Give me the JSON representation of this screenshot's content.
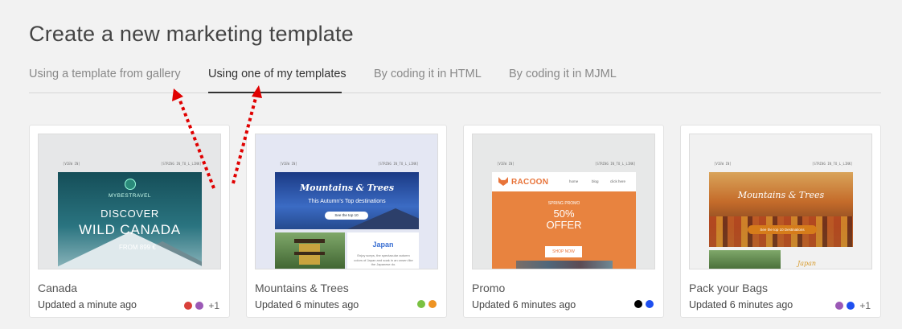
{
  "page": {
    "title": "Create a new marketing template"
  },
  "tabs": [
    {
      "label": "Using a template from gallery",
      "active": false
    },
    {
      "label": "Using one of my templates",
      "active": true
    },
    {
      "label": "By coding it in HTML",
      "active": false
    },
    {
      "label": "By coding it in MJML",
      "active": false
    }
  ],
  "cards": [
    {
      "name": "Canada",
      "updated": "Updated a minute ago",
      "colors": [
        "#d9403a",
        "#9b59b6"
      ],
      "more": "+1",
      "preview": {
        "brand": "MYBESTRAVEL",
        "line1": "DISCOVER",
        "line2": "WILD CANADA",
        "price": "FROM 899 €"
      }
    },
    {
      "name": "Mountains & Trees",
      "updated": "Updated 6 minutes ago",
      "colors": [
        "#7ac142",
        "#ee9322"
      ],
      "more": "",
      "preview": {
        "script": "Mountains & Trees",
        "sub": "This Autumn's Top destinations",
        "pill": "See the top 10",
        "japan": "Japan",
        "japan_text": "Enjoy sceps, the spectacular autumn colors of Japan and soak in an onsen like the Japanese do."
      }
    },
    {
      "name": "Promo",
      "updated": "Updated 6 minutes ago",
      "colors": [
        "#000000",
        "#1e4ff0"
      ],
      "more": "",
      "preview": {
        "logo": "RACOON",
        "nav_home": "home",
        "nav_blog": "blog",
        "nav_more": "click here",
        "kicker": "SPRING PROMO",
        "percent": "50%",
        "offer": "OFFER",
        "shop": "SHOP NOW"
      }
    },
    {
      "name": "Pack your Bags",
      "updated": "Updated 6 minutes ago",
      "colors": [
        "#9b59b6",
        "#1e4ff0"
      ],
      "more": "+1",
      "preview": {
        "script": "Mountains & Trees",
        "cta": "See the top 10 Destinations",
        "japan": "Japan"
      }
    }
  ],
  "preview_tokens": {
    "left": "[VIEW IN]",
    "right": "[STRING IN_TO_L_LINK]"
  },
  "accent_color": "#e00000"
}
